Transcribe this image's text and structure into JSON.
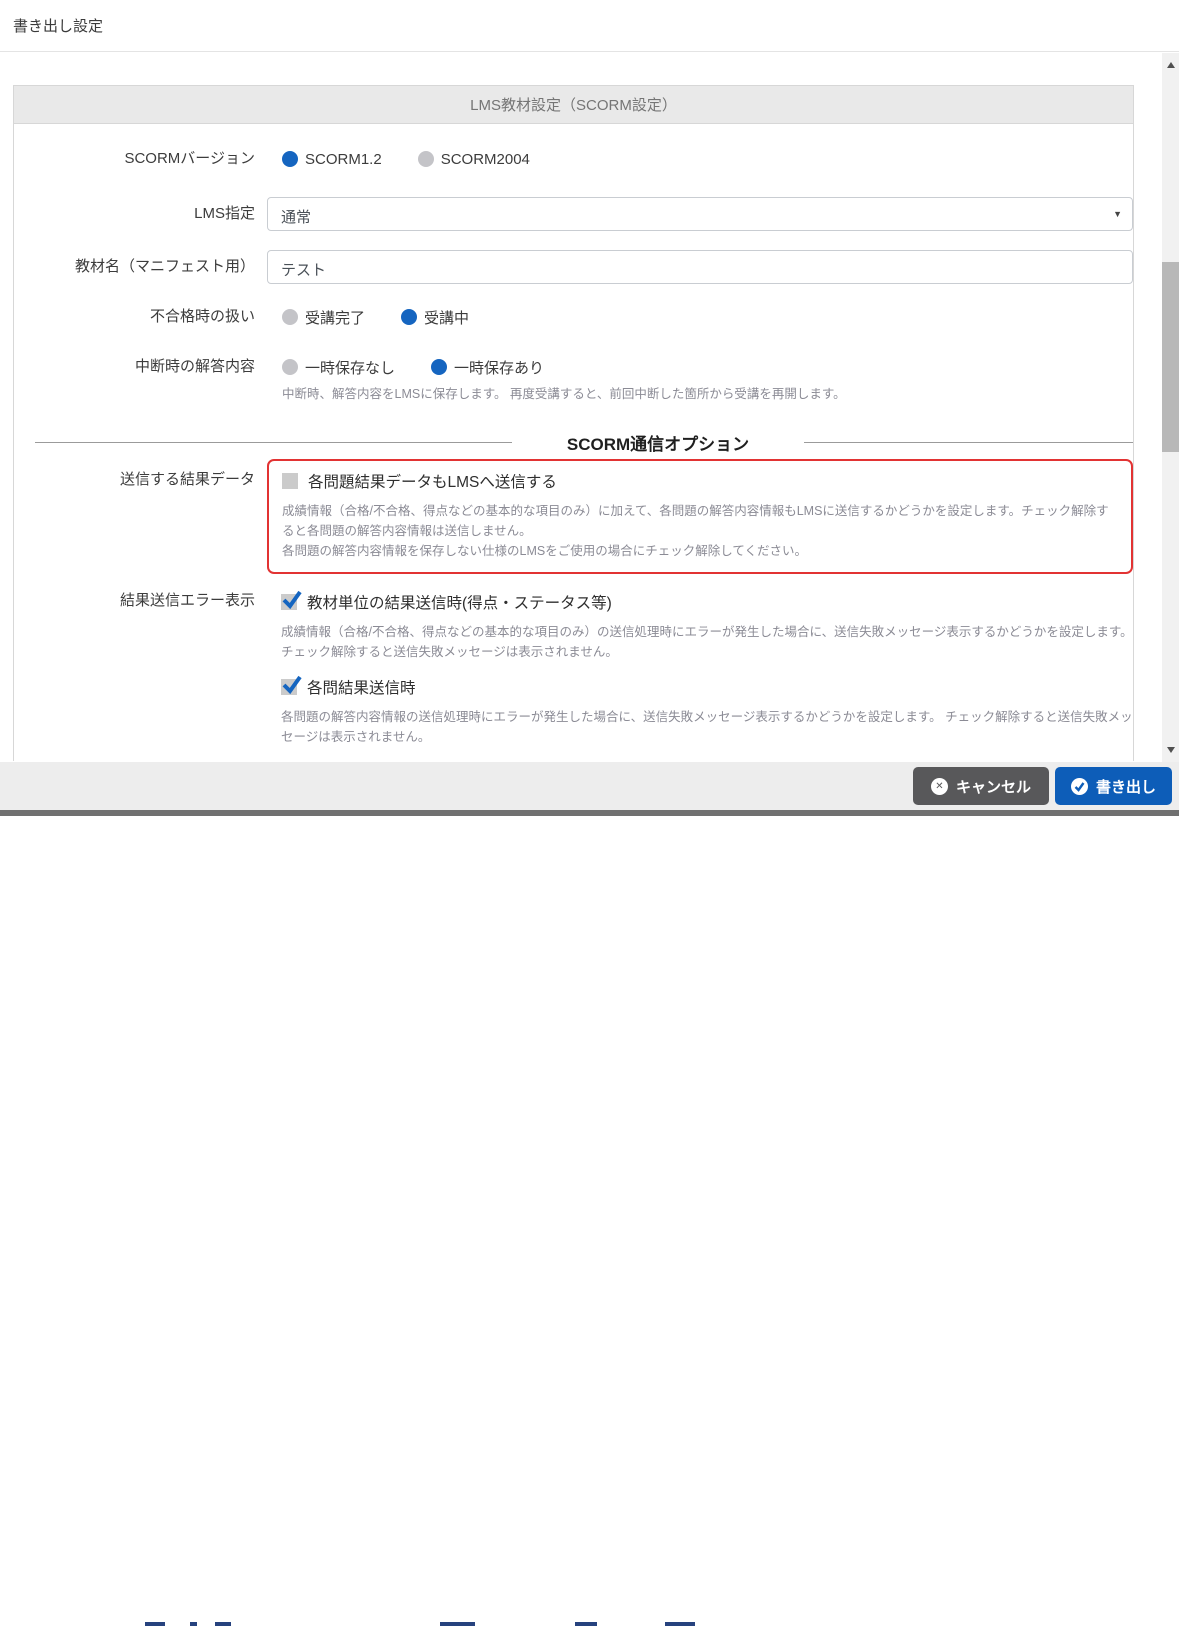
{
  "page": {
    "title": "書き出し設定"
  },
  "panel": {
    "header": "LMS教材設定（SCORM設定）"
  },
  "form": {
    "scorm_version": {
      "label": "SCORMバージョン",
      "options": [
        {
          "label": "SCORM1.2",
          "selected": true
        },
        {
          "label": "SCORM2004",
          "selected": false
        }
      ]
    },
    "lms": {
      "label": "LMS指定",
      "value": "通常"
    },
    "material_name": {
      "label": "教材名（マニフェスト用）",
      "value": "テスト"
    },
    "fail_handling": {
      "label": "不合格時の扱い",
      "options": [
        {
          "label": "受講完了",
          "selected": false
        },
        {
          "label": "受講中",
          "selected": true
        }
      ]
    },
    "suspend": {
      "label": "中断時の解答内容",
      "options": [
        {
          "label": "一時保存なし",
          "selected": false
        },
        {
          "label": "一時保存あり",
          "selected": true
        }
      ],
      "help": "中断時、解答内容をLMSに保存します。 再度受講すると、前回中断した箇所から受講を再開します。"
    },
    "section_title": "SCORM通信オプション",
    "result_data": {
      "label": "送信する結果データ",
      "checkbox_label": "各問題結果データもLMSへ送信する",
      "checked": false,
      "help1": "成績情報（合格/不合格、得点などの基本的な項目のみ）に加えて、各問題の解答内容情報もLMSに送信するかどうかを設定します。チェック解除すると各問題の解答内容情報は送信しません。",
      "help2": "各問題の解答内容情報を保存しない仕様のLMSをご使用の場合にチェック解除してください。"
    },
    "error_display": {
      "label": "結果送信エラー表示",
      "item1": {
        "checkbox_label": "教材単位の結果送信時(得点・ステータス等)",
        "checked": true,
        "help": "成績情報（合格/不合格、得点などの基本的な項目のみ）の送信処理時にエラーが発生した場合に、送信失敗メッセージ表示するかどうかを設定します。 チェック解除すると送信失敗メッセージは表示されません。"
      },
      "item2": {
        "checkbox_label": "各問結果送信時",
        "checked": true,
        "help": "各問題の解答内容情報の送信処理時にエラーが発生した場合に、送信失敗メッセージ表示するかどうかを設定します。 チェック解除すると送信失敗メッセージは表示されません。"
      }
    }
  },
  "footer": {
    "cancel_label": "キャンセル",
    "export_label": "書き出し"
  },
  "colors": {
    "accent_blue": "#0d5db8",
    "radio_blue": "#1565c0",
    "highlight_red": "#e23333",
    "cancel_gray": "#58585a",
    "panel_header_bg": "#e9e9e9"
  }
}
